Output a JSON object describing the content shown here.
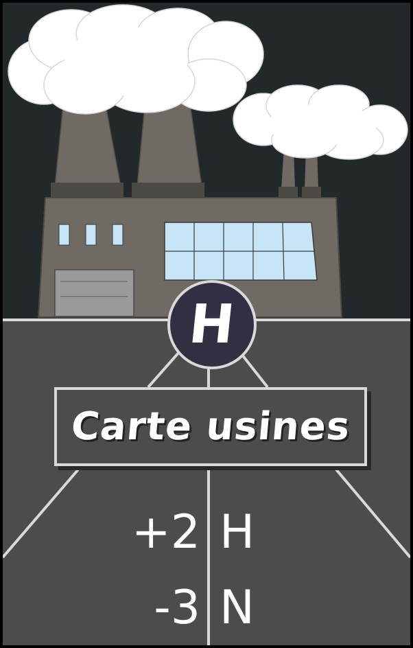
{
  "card": {
    "badge_letter": "H",
    "title": "Carte usines",
    "effects": [
      {
        "value": "+2",
        "resource": "H"
      },
      {
        "value": "-3",
        "resource": "N"
      }
    ]
  },
  "colors": {
    "sky": "#23282b",
    "ground": "#4c4c4c",
    "factory": "#6f6a63",
    "chimney": "#6f6a63",
    "window": "#c6e6f8",
    "smoke": "#ffffff",
    "road_lines": "#d9d9d9",
    "badge": "#332f43"
  },
  "icons": [
    "factory-illustration",
    "smoke-cloud",
    "chimney"
  ]
}
